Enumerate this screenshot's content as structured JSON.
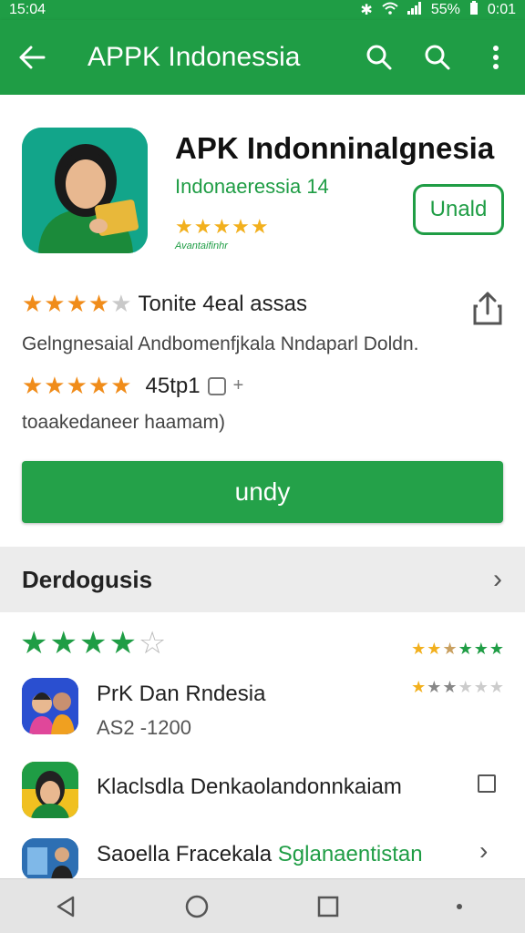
{
  "status_bar": {
    "time": "15:04",
    "battery": "55%",
    "extra": "0:01"
  },
  "app_bar": {
    "title": "APPK Indonessia"
  },
  "app": {
    "name": "APK Indonninalgnesia",
    "developer": "Indonaeressia 14",
    "small_caption": "Avantaifinhr",
    "install_label": "Unald",
    "rating_label": "Tonite 4eal assas",
    "description": "Gelngnesaial Andbomenfjkala Nndaparl Doldn.",
    "review_count": "45tp1",
    "plus": "+",
    "sub_text": "toaakedaneer haamam)",
    "primary_button": "undy"
  },
  "section": {
    "title": "Derdogusis"
  },
  "list": {
    "big_rating": {
      "filled": 4,
      "total": 5
    },
    "items": [
      {
        "name": "PrK Dan Rndesia",
        "sub": "AS2 -1200"
      },
      {
        "name": "Klaclsdla Denkaolandonnkaiam"
      },
      {
        "name_plain": "Saoella Fracekala ",
        "name_green": "Sglanaentistan"
      }
    ]
  },
  "colors": {
    "primary": "#1f9d45",
    "star_orange": "#f08c1a",
    "star_gold": "#f2b01e"
  },
  "icons": [
    "back-arrow-icon",
    "search-icon",
    "search-icon-2",
    "more-vert-icon",
    "share-icon",
    "chevron-right-icon",
    "back-nav-icon",
    "home-nav-icon",
    "recents-nav-icon"
  ]
}
